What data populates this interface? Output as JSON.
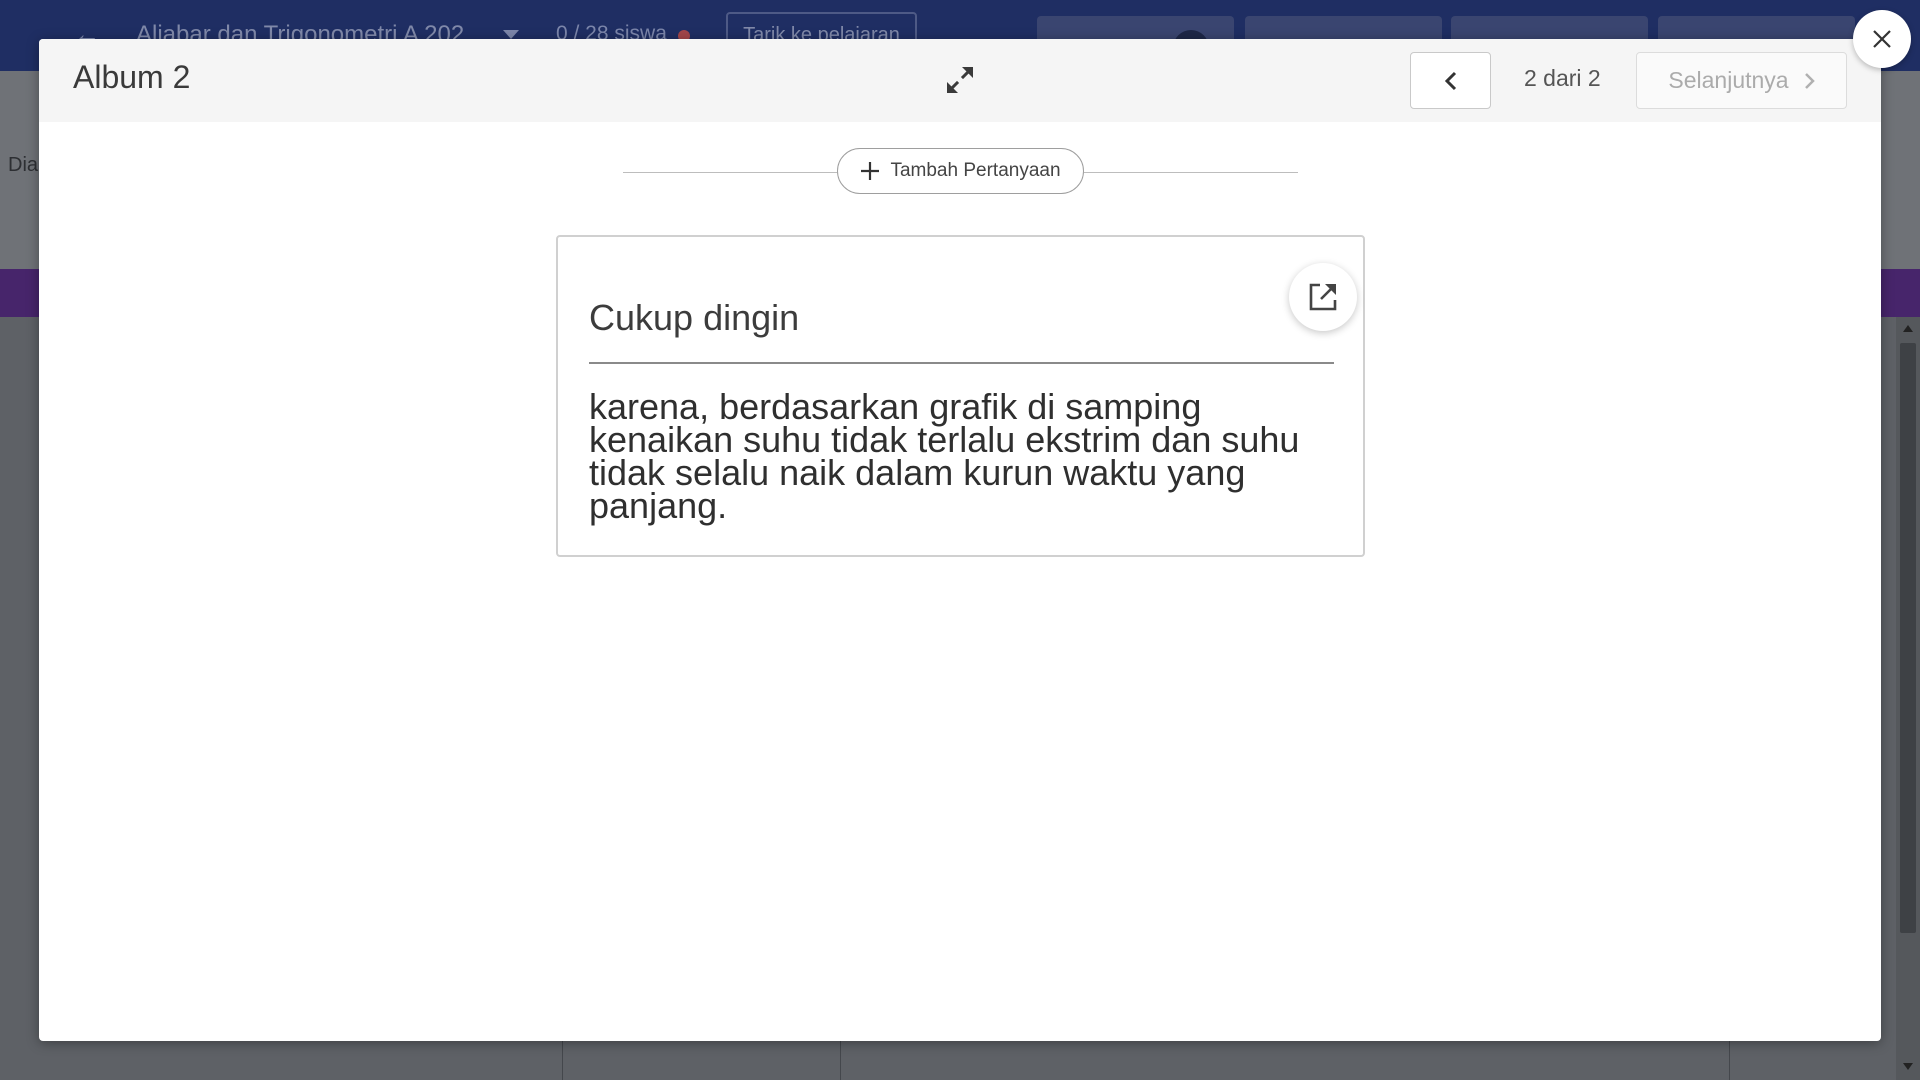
{
  "background": {
    "course_title": "Aljabar dan Trigonometri A 202",
    "student_count": "0 / 28 siswa",
    "pull_button": "Tarik ke pelajaran",
    "side_text": "Dia"
  },
  "modal": {
    "title": "Album 2",
    "pagination": {
      "indicator": "2 dari 2",
      "next_label": "Selanjutnya"
    },
    "add_question_label": "Tambah Pertanyaan",
    "card": {
      "heading": "Cukup dingin",
      "body": "karena, berdasarkan grafik di samping kenaikan suhu tidak terlalu ekstrim dan suhu tidak selalu naik dalam kurun waktu yang panjang."
    }
  },
  "icons": {
    "back": "arrow-left-icon",
    "expand": "expand-icon",
    "prev": "chevron-left-icon",
    "next": "chevron-right-icon",
    "add": "plus-icon",
    "open": "external-link-icon",
    "close": "close-icon"
  },
  "colors": {
    "topbar": "#1f2e63",
    "purple_band": "#47256b",
    "modal_header": "#f5f5f5"
  }
}
